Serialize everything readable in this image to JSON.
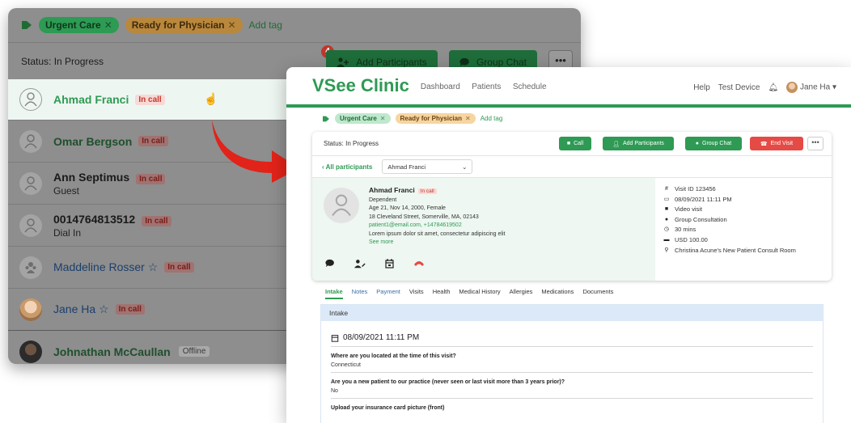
{
  "back_panel": {
    "tags": [
      {
        "label": "Urgent Care",
        "color": "green"
      },
      {
        "label": "Ready for Physician",
        "color": "orange"
      }
    ],
    "add_tag": "Add tag",
    "status": "Status: In Progress",
    "add_participants": "Add Participants",
    "group_chat": "Group Chat",
    "more": "•••",
    "badge_count": "4",
    "participants": [
      {
        "name": "Ahmad Franci",
        "sub": "",
        "state": "In call",
        "selected": true
      },
      {
        "name": "Omar Bergson",
        "sub": "",
        "state": "In call"
      },
      {
        "name": "Ann Septimus",
        "sub": "Guest",
        "state": "In call"
      },
      {
        "name": "0014764813512",
        "sub": "Dial In",
        "state": "In call"
      },
      {
        "name": "Maddeline Rosser ☆",
        "sub": "",
        "state": "In call"
      },
      {
        "name": "Jane Ha ☆",
        "sub": "",
        "state": "In call"
      },
      {
        "name": "Johnathan McCaullan",
        "sub": "",
        "state": "Offline"
      }
    ]
  },
  "front_panel": {
    "logo": "VSee Clinic",
    "nav": [
      "Dashboard",
      "Patients",
      "Schedule"
    ],
    "help": "Help",
    "test_device": "Test Device",
    "user_name": "Jane Ha ▾",
    "tags": [
      "Urgent Care",
      "Ready for Physician"
    ],
    "add_tag": "Add tag",
    "status": "Status: In Progress",
    "buttons": {
      "call": "Call",
      "add_participants": "Add Participants",
      "group_chat": "Group Chat",
      "end_visit": "End Visit",
      "more": "•••"
    },
    "all_participants": "‹ All participants",
    "selected_participant": "Ahmad Franci",
    "patient": {
      "name": "Ahmad Franci",
      "state": "In call",
      "relation": "Dependent",
      "age": "Age 21, Nov 14, 2000, Female",
      "address": "18 Cleveland Street, Somerville, MA, 02143",
      "contact": "patient1@email.com, +14784619502",
      "note": "Lorem ipsum dolor sit amet, consectetur adipiscing elit",
      "see_more": "See more"
    },
    "meta": [
      {
        "icon": "#",
        "text": "Visit ID 123456"
      },
      {
        "icon": "▭",
        "text": "08/09/2021 11:11 PM"
      },
      {
        "icon": "■",
        "text": "Video visit"
      },
      {
        "icon": "●",
        "text": "Group Consultation"
      },
      {
        "icon": "◷",
        "text": "30 mins"
      },
      {
        "icon": "▬",
        "text": "USD 100.00"
      },
      {
        "icon": "⚲",
        "text": "Christina Acune's New Patient Consult Room"
      }
    ],
    "tabs": [
      "Intake",
      "Notes",
      "Payment",
      "Visits",
      "Health",
      "Medical History",
      "Allergies",
      "Medications",
      "Documents"
    ],
    "intake": {
      "header": "Intake",
      "datetime": "08/09/2021  11:11 PM",
      "qa": [
        {
          "q": "Where are you located at the time of this visit?",
          "a": "Connecticut"
        },
        {
          "q": "Are you a new patient to our practice (never seen or last visit more than 3 years prior)?",
          "a": "No"
        },
        {
          "q": "Upload your insurance card picture (front)",
          "a": ""
        }
      ]
    }
  }
}
